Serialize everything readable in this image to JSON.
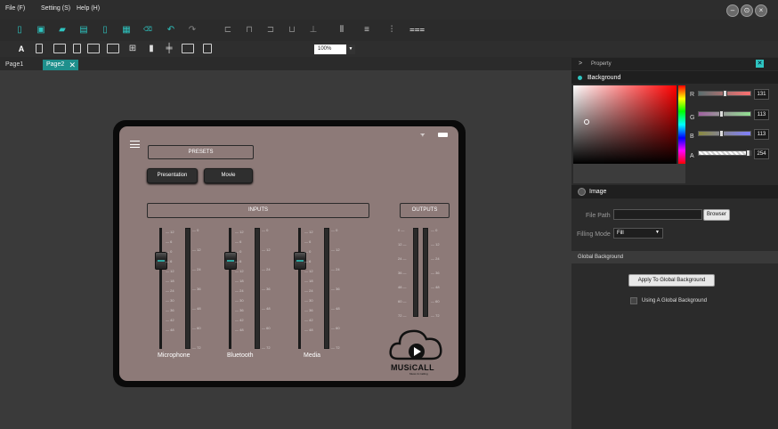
{
  "menubar": {
    "items": [
      "File (F)",
      "Setting (S)",
      "Help (H)"
    ]
  },
  "window_controls": {
    "minimize": "–",
    "maximize": "⊙",
    "close": "×"
  },
  "toolbar2": {
    "zoom": "100%"
  },
  "tabs": [
    {
      "label": "Page1"
    },
    {
      "label": "Page2"
    }
  ],
  "device": {
    "presets_label": "PRESETS",
    "preset_buttons": [
      "Presentation",
      "Movie"
    ],
    "inputs_label": "INPUTS",
    "outputs_label": "OUTPUTS",
    "channels": [
      "Microphone",
      "Bluetooth",
      "Media"
    ],
    "fader_ticks": [
      "12",
      "6",
      "0",
      "6",
      "12",
      "18",
      "24",
      "30",
      "36",
      "42",
      "48"
    ],
    "meter_ticks": [
      "0",
      "12",
      "24",
      "36",
      "48",
      "60",
      "72"
    ],
    "output_meter_ticks": [
      "0",
      "12",
      "24",
      "36",
      "48",
      "60",
      "72"
    ],
    "logo_text": "MUSiCALL",
    "logo_subtext": "Music & Calling"
  },
  "property_panel": {
    "title": "Property",
    "background_label": "Background",
    "sliders": [
      {
        "label": "R",
        "value": "131",
        "level": 0.51
      },
      {
        "label": "G",
        "value": "113",
        "level": 0.44
      },
      {
        "label": "B",
        "value": "113",
        "level": 0.44
      },
      {
        "label": "A",
        "value": "254",
        "level": 0.99
      }
    ],
    "image_label": "Image",
    "file_path_label": "File Path",
    "browser_button": "Browser",
    "filling_mode_label": "Filling Mode",
    "filling_mode_value": "Fill",
    "global_background_label": "Global Background",
    "apply_button": "Apply To Global Background",
    "using_global_label": "Using A Global Background"
  }
}
